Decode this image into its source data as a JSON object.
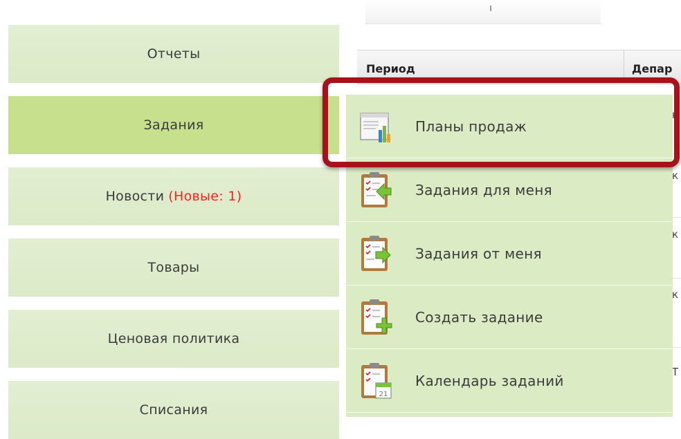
{
  "sidebar": {
    "items": [
      {
        "label": "Отчеты"
      },
      {
        "label": "Задания"
      },
      {
        "label": "Новости",
        "badge": "(Новые: 1)"
      },
      {
        "label": "Товары"
      },
      {
        "label": "Ценовая политика"
      },
      {
        "label": "Списания"
      }
    ]
  },
  "table": {
    "headers": [
      "Период",
      "Депар"
    ],
    "row_fragments": [
      "к",
      "к",
      "к",
      "Т"
    ]
  },
  "submenu": {
    "items": [
      {
        "label": "Планы продаж",
        "icon": "sales-plan-chart-icon"
      },
      {
        "label": "Задания для меня",
        "icon": "clipboard-arrow-in-icon"
      },
      {
        "label": "Задания от меня",
        "icon": "clipboard-arrow-out-icon"
      },
      {
        "label": "Создать задание",
        "icon": "clipboard-add-icon"
      },
      {
        "label": "Календарь заданий",
        "icon": "clipboard-calendar-icon"
      }
    ],
    "calendar_day": "21"
  },
  "colors": {
    "nav_bg": "#dbeac8",
    "nav_active_bg": "#c7e08e",
    "badge_red": "#ff1e1e",
    "highlight_frame": "#a8101a"
  }
}
